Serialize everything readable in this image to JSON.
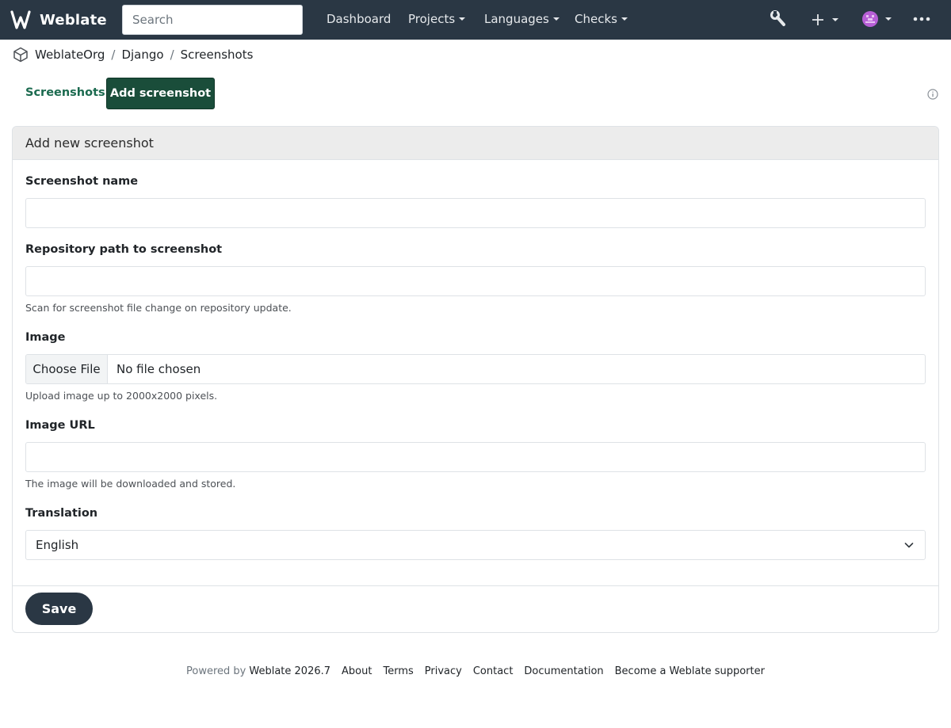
{
  "brand": {
    "name": "Weblate"
  },
  "search": {
    "placeholder": "Search"
  },
  "nav": {
    "items": [
      {
        "label": "Dashboard",
        "dropdown": false
      },
      {
        "label": "Projects",
        "dropdown": true
      },
      {
        "label": "Languages",
        "dropdown": true
      },
      {
        "label": "Checks",
        "dropdown": true
      }
    ],
    "icons": [
      "wrench-icon",
      "plus-icon",
      "avatar-icon",
      "more-icon"
    ]
  },
  "breadcrumb": {
    "items": [
      "WeblateOrg",
      "Django",
      "Screenshots"
    ]
  },
  "tabs": {
    "screenshots": "Screenshots",
    "add": "Add screenshot"
  },
  "form": {
    "title": "Add new screenshot",
    "name_label": "Screenshot name",
    "name_value": "",
    "repo_label": "Repository path to screenshot",
    "repo_value": "",
    "repo_help": "Scan for screenshot file change on repository update.",
    "image_label": "Image",
    "image_button": "Choose File",
    "image_status": "No file chosen",
    "image_help": "Upload image up to 2000x2000 pixels.",
    "url_label": "Image URL",
    "url_value": "",
    "url_help": "The image will be downloaded and stored.",
    "translation_label": "Translation",
    "translation_value": "English",
    "save": "Save"
  },
  "footer": {
    "powered_by": "Powered by",
    "powered_link": "Weblate 2026.7",
    "links": [
      "About",
      "Terms",
      "Privacy",
      "Contact",
      "Documentation",
      "Become a Weblate supporter"
    ]
  },
  "colors": {
    "navbar": "#2a3744",
    "accent_green": "#1b6a4f",
    "add_button": "#1a4d3a",
    "save_button": "#2a3744"
  }
}
